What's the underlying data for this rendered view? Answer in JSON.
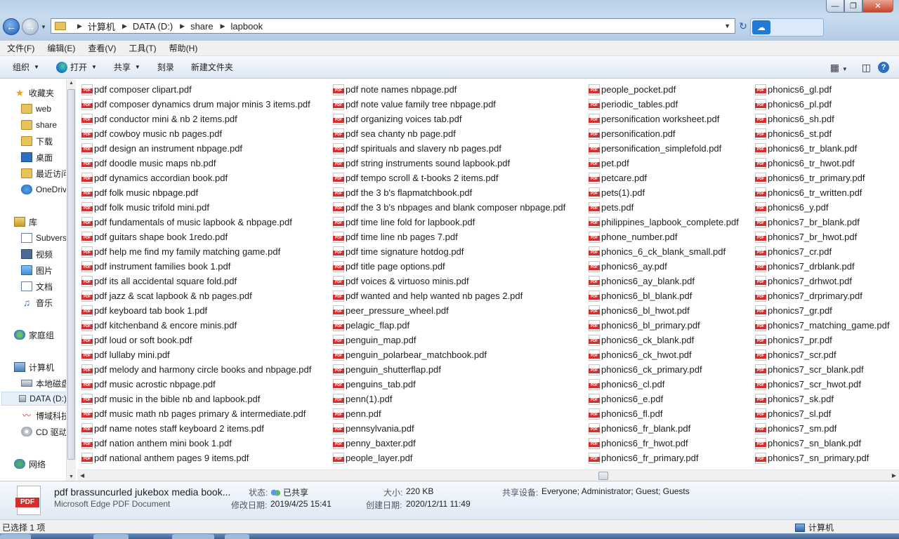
{
  "window": {
    "minimize_glyph": "—",
    "maximize_glyph": "❐",
    "close_glyph": "✕"
  },
  "address": {
    "crumbs": [
      "计算机",
      "DATA (D:)",
      "share",
      "lapbook"
    ]
  },
  "menu": [
    "文件(F)",
    "编辑(E)",
    "查看(V)",
    "工具(T)",
    "帮助(H)"
  ],
  "commands": {
    "organize": "组织",
    "open": "打开",
    "share": "共享",
    "burn": "刻录",
    "new_folder": "新建文件夹"
  },
  "sidebar": {
    "favorites": "收藏夹",
    "items": [
      "web",
      "share",
      "下载",
      "桌面",
      "最近访问",
      "OneDrive"
    ],
    "libraries": "库",
    "lib_items": [
      "Subversion",
      "视频",
      "图片",
      "文档",
      "音乐"
    ],
    "homegroup": "家庭组",
    "computer": "计算机",
    "computer_items": [
      "本地磁盘",
      "DATA (D:)",
      "博域科技",
      "CD 驱动器"
    ],
    "network": "网络"
  },
  "files": {
    "col1": [
      "pdf composer clipart.pdf",
      "pdf composer dynamics drum major minis 3 items.pdf",
      "pdf conductor mini & nb 2 items.pdf",
      "pdf cowboy music nb pages.pdf",
      "pdf design an instrument nbpage.pdf",
      "pdf doodle music maps nb.pdf",
      "pdf dynamics accordian book.pdf",
      "pdf folk music nbpage.pdf",
      "pdf folk music trifold mini.pdf",
      "pdf fundamentals of music lapbook & nbpage.pdf",
      "pdf guitars shape book 1redo.pdf",
      "pdf help me find my family matching game.pdf",
      "pdf instrument families book 1.pdf",
      "pdf its all accidental square fold.pdf",
      "pdf jazz & scat lapbook & nb pages.pdf",
      "pdf keyboard tab book 1.pdf",
      "pdf kitchenband & encore  minis.pdf",
      "pdf loud or soft book.pdf",
      "pdf lullaby mini.pdf",
      "pdf melody and harmony circle books and nbpage.pdf",
      "pdf music acrostic nbpage.pdf",
      "pdf music in the bible nb and lapbook.pdf",
      "pdf music math nb pages primary & intermediate.pdf",
      "pdf name notes staff keyboard 2 items.pdf",
      "pdf nation anthem mini book 1.pdf",
      "pdf national anthem pages 9 items.pdf"
    ],
    "col2": [
      "pdf note names nbpage.pdf",
      "pdf note value family tree nbpage.pdf",
      "pdf organizing voices tab.pdf",
      "pdf sea chanty nb page.pdf",
      "pdf spirituals and slavery nb pages.pdf",
      "pdf string instruments sound lapbook.pdf",
      "pdf tempo scroll & t-books 2 items.pdf",
      "pdf the 3 b's flapmatchbook.pdf",
      "pdf the 3 b's nbpages and blank composer nbpage.pdf",
      "pdf time line fold for lapbook.pdf",
      "pdf time line nb pages 7.pdf",
      "pdf time signature hotdog.pdf",
      "pdf title page options.pdf",
      "pdf voices & virtuoso minis.pdf",
      "pdf wanted and help wanted nb pages 2.pdf",
      "peer_pressure_wheel.pdf",
      "pelagic_flap.pdf",
      "penguin_map.pdf",
      "penguin_polarbear_matchbook.pdf",
      "penguin_shutterflap.pdf",
      "penguins_tab.pdf",
      "penn(1).pdf",
      "penn.pdf",
      "pennsylvania.pdf",
      "penny_baxter.pdf",
      "people_layer.pdf"
    ],
    "col3": [
      "people_pocket.pdf",
      "periodic_tables.pdf",
      "personification worksheet.pdf",
      "personification.pdf",
      "personification_simplefold.pdf",
      "pet.pdf",
      "petcare.pdf",
      "pets(1).pdf",
      "pets.pdf",
      "philippines_lapbook_complete.pdf",
      "phone_number.pdf",
      "phonics_6_ck_blank_small.pdf",
      "phonics6_ay.pdf",
      "phonics6_ay_blank.pdf",
      "phonics6_bl_blank.pdf",
      "phonics6_bl_hwot.pdf",
      "phonics6_bl_primary.pdf",
      "phonics6_ck_blank.pdf",
      "phonics6_ck_hwot.pdf",
      "phonics6_ck_primary.pdf",
      "phonics6_cl.pdf",
      "phonics6_e.pdf",
      "phonics6_fl.pdf",
      "phonics6_fr_blank.pdf",
      "phonics6_fr_hwot.pdf",
      "phonics6_fr_primary.pdf"
    ],
    "col4": [
      "phonics6_gl.pdf",
      "phonics6_pl.pdf",
      "phonics6_sh.pdf",
      "phonics6_st.pdf",
      "phonics6_tr_blank.pdf",
      "phonics6_tr_hwot.pdf",
      "phonics6_tr_primary.pdf",
      "phonics6_tr_written.pdf",
      "phonics6_y.pdf",
      "phonics7_br_blank.pdf",
      "phonics7_br_hwot.pdf",
      "phonics7_cr.pdf",
      "phonics7_drblank.pdf",
      "phonics7_drhwot.pdf",
      "phonics7_drprimary.pdf",
      "phonics7_gr.pdf",
      "phonics7_matching_game.pdf",
      "phonics7_pr.pdf",
      "phonics7_scr.pdf",
      "phonics7_scr_blank.pdf",
      "phonics7_scr_hwot.pdf",
      "phonics7_sk.pdf",
      "phonics7_sl.pdf",
      "phonics7_sm.pdf",
      "phonics7_sn_blank.pdf",
      "phonics7_sn_primary.pdf"
    ]
  },
  "details": {
    "name": "pdf brassuncurled jukebox media book...",
    "type": "Microsoft Edge PDF Document",
    "state_label": "状态:",
    "state_value": "已共享",
    "modified_label": "修改日期:",
    "modified_value": "2019/4/25 15:41",
    "size_label": "大小:",
    "size_value": "220 KB",
    "created_label": "创建日期:",
    "created_value": "2020/12/11 11:49",
    "share_label": "共享设备:",
    "share_value": "Everyone; Administrator; Guest; Guests",
    "icon_text": "PDF"
  },
  "status": {
    "selection": "已选择 1 项",
    "location": "计算机"
  }
}
